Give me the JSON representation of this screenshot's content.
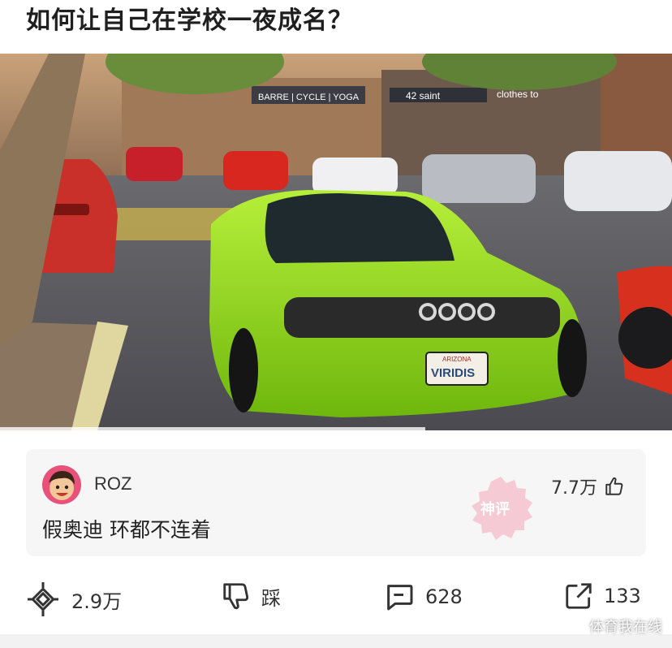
{
  "post": {
    "title": "如何让自己在学校一夜成名？"
  },
  "photo": {
    "description_icon": "photo-green-sports-car",
    "plate_text": "VIRIDIS",
    "plate_state": "ARIZONA",
    "storefront_1": "BARRE | CYCLE | YOGA",
    "storefront_2": "42 saint",
    "storefront_3": "clothes to"
  },
  "comment": {
    "username": "ROZ",
    "text": "假奥迪 环都不连着",
    "likes": "7.7万",
    "like_icon": "thumbs-up-icon",
    "stamp_icon": "god-comment-stamp",
    "stamp_text": "神评"
  },
  "actions": {
    "share_count": "2.9万",
    "dislike_label": "踩",
    "comments_count": "628",
    "forward_count": "133"
  },
  "watermark": "体育我在线",
  "colors": {
    "car_green": "#8fd61a",
    "avatar_bg": "#e8517a",
    "card_bg": "#f6f6f7",
    "stamp_pink": "#f4a7b9"
  }
}
